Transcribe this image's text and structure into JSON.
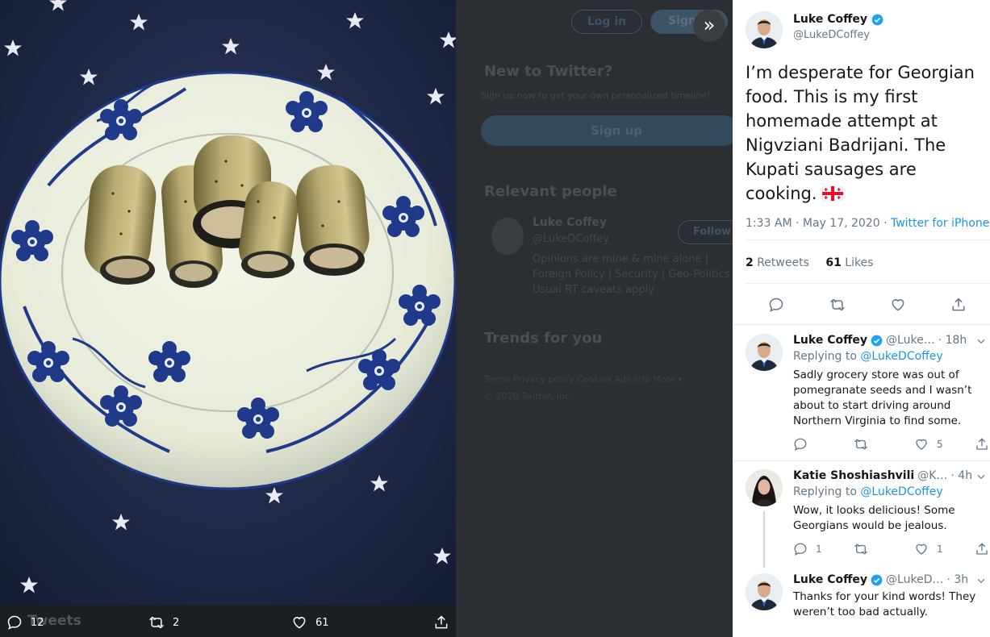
{
  "background": {
    "login_label": "Log in",
    "signup_label": "Sign",
    "new_to_twitter_heading": "New to Twitter?",
    "new_to_twitter_sub": "Sign up now to get your own personalized timeline!",
    "signup_big_label": "Sign up",
    "relevant_people_heading": "Relevant people",
    "person_name": "Luke Coffey",
    "person_handle": "@LukeDCoffey",
    "follow_label": "Follow",
    "person_bio": "Opinions are mine & mine alone | Foreign Policy | Security | Geo-Politics | Usual RT caveats apply",
    "trends_heading": "Trends for you",
    "footer_links": "Terms   Privacy policy   Cookies   Ads info   More ▾",
    "footer_copyright": "© 2020 Twitter, Inc.",
    "tweets_label": "Tweets"
  },
  "photo_bar": {
    "reply_count": "12",
    "retweet_count": "2",
    "like_count": "61"
  },
  "tweet": {
    "author_name": "Luke Coffey",
    "author_handle": "@LukeDCoffey",
    "text": "I’m desperate for Georgian food. This is my first homemade attempt at Nigvziani Badrijani. The Kupati sausages are cooking.",
    "time": "1:33 AM · May 17, 2020 · ",
    "source": "Twitter for iPhone",
    "retweets_count": "2",
    "retweets_label": " Retweets",
    "likes_count": "61",
    "likes_label": " Likes"
  },
  "replies": [
    {
      "name": "Luke Coffey",
      "handle": "@Luke…",
      "age": "· 18h",
      "replying_prefix": "Replying to ",
      "replying_to": "@LukeDCoffey",
      "text": "Sadly grocery store was out of pomegranate seeds and I wasn’t about to start driving around Northern Virginia to find some.",
      "reply_count": "",
      "retweet_count": "",
      "like_count": "5"
    },
    {
      "name": "Katie Shoshiashvili",
      "handle": "@K…",
      "age": "· 4h",
      "replying_prefix": "Replying to ",
      "replying_to": "@LukeDCoffey",
      "text": "Wow, it looks delicious! Some Georgians would be jealous.",
      "reply_count": "1",
      "retweet_count": "",
      "like_count": "1"
    },
    {
      "name": "Luke Coffey",
      "handle": "@LukeD…",
      "age": "· 3h",
      "text": "Thanks for your kind words! They weren’t too bad actually."
    }
  ],
  "colors": {
    "accent": "#1b95e0",
    "verified": "#1da1f2",
    "tablecloth": "#1f2a48",
    "plate_blue": "#1f3a8a"
  }
}
